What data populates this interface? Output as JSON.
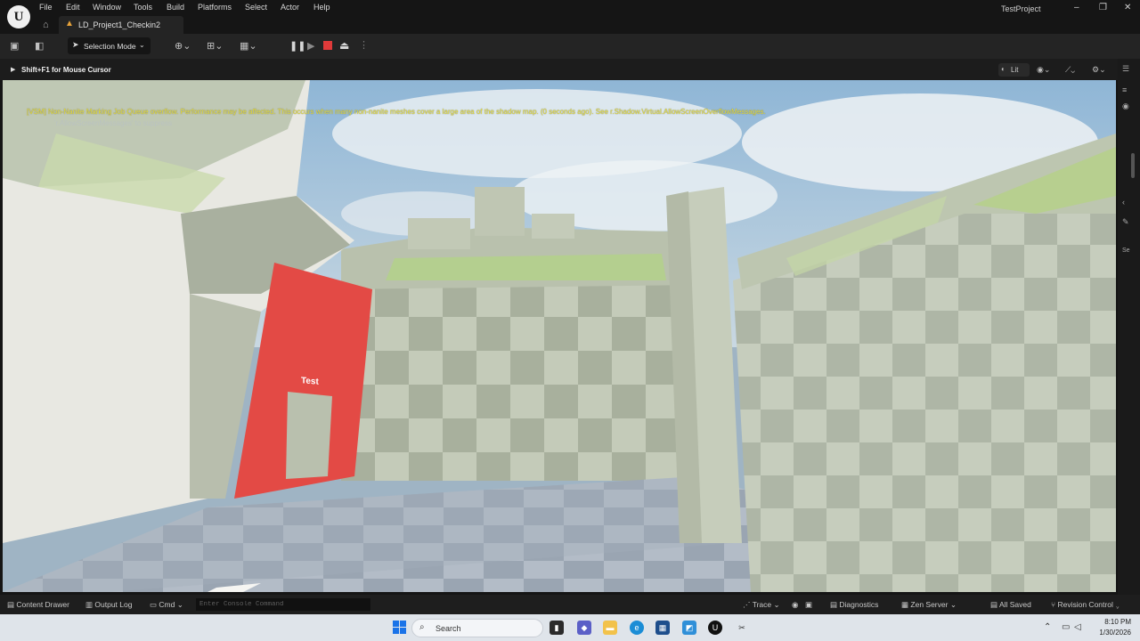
{
  "menu": [
    "File",
    "Edit",
    "Window",
    "Tools",
    "Build",
    "Platforms",
    "Select",
    "Actor",
    "Help"
  ],
  "level_tab": "LD_Project1_Checkin2",
  "project_name": "TestProject",
  "toolbar": {
    "selection_mode": "Selection Mode"
  },
  "viewport": {
    "hint": "Shift+F1 for Mouse Cursor",
    "view_mode": "Lit",
    "warning": "[VSM] Non-Nanite Marking Job Queue overflow. Performance may be affected. This occurs when many non-nanite meshes cover a large area of the shadow map. (0 seconds ago). See r.Shadow.Virtual.AllowScreenOverflowMessages.",
    "suppress": "'r.AllowScreenMessages' to suppress",
    "sign_text": "Test"
  },
  "statusbar": {
    "content_drawer": "Content Drawer",
    "output_log": "Output Log",
    "cmd": "Cmd",
    "console_placeholder": "Enter Console Command",
    "trace": "Trace",
    "diagnostics": "Diagnostics",
    "zen_server": "Zen Server",
    "all_saved": "All Saved",
    "revision_control": "Revision Control"
  },
  "taskbar": {
    "search": "Search",
    "time": "8:10 PM",
    "date": "1/30/2026"
  },
  "colors": {
    "accent_red": "#e03a3a",
    "warning_yellow": "#e7e03c",
    "level_icon": "#e8a33a"
  }
}
